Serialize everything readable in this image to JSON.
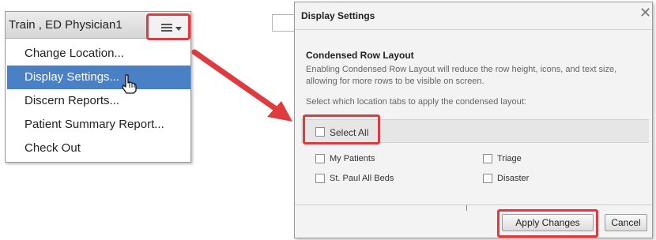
{
  "left_menu": {
    "user_name": "Train , ED Physician1",
    "menu_button_icon": "hamburger-menu-icon",
    "items": [
      {
        "label": "Change Location..."
      },
      {
        "label": "Display Settings..."
      },
      {
        "label": "Discern Reports..."
      },
      {
        "label": "Patient Summary Report..."
      },
      {
        "label": "Check Out"
      }
    ],
    "active_index": 1
  },
  "dialog": {
    "title": "Display Settings",
    "close_icon": "close-icon",
    "section_title": "Condensed Row Layout",
    "description": "Enabling Condensed Row Layout will reduce the row height, icons, and text size, allowing for more rows to be visible on screen.",
    "instruction": "Select which location tabs to apply the condensed layout:",
    "select_all_label": "Select All",
    "options": [
      {
        "label": "My Patients",
        "checked": false
      },
      {
        "label": "Triage",
        "checked": false
      },
      {
        "label": "St. Paul All Beds",
        "checked": false
      },
      {
        "label": "Disaster",
        "checked": false
      }
    ],
    "apply_label": "Apply Changes",
    "cancel_label": "Cancel"
  },
  "colors": {
    "highlight_red": "#e03a3e",
    "menu_active_blue": "#4a80c6"
  }
}
